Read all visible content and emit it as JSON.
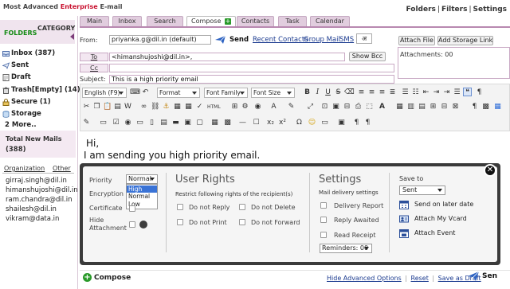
{
  "brand": {
    "prefix": "Most Advanced ",
    "highlight": "Enterprise",
    "suffix": " E-mail"
  },
  "top_links": [
    "Folders",
    "Filters",
    "Settings"
  ],
  "tabs": [
    "Main",
    "Inbox",
    "Search",
    "Compose",
    "Contacts",
    "Task",
    "Calendar"
  ],
  "sidebar": {
    "folders_title": "FOLDERS",
    "category_title": "CATEGORY",
    "folders": [
      {
        "label": "Inbox (387)"
      },
      {
        "label": "Sent"
      },
      {
        "label": "Draft"
      },
      {
        "label": "Trash[Empty] (14)"
      },
      {
        "label": "Secure (1)"
      },
      {
        "label": "Storage"
      }
    ],
    "more": "2 More..",
    "new_mail_label": "Total New Mails",
    "new_mail_count": "(388)",
    "org_label": "Organization",
    "other_label": "Other",
    "contacts": [
      "girraj.singh@dil.in",
      "himanshujoshi@dil.in",
      "ram.chandra@dil.in",
      "shailesh@dil.in",
      "vikram@data.in"
    ]
  },
  "compose": {
    "from_label": "From:",
    "from_value": "priyanka.g@dil.in (default)",
    "send_label": "Send",
    "links": [
      "Recent Contacts",
      "Group Mail",
      "SMS"
    ],
    "lang_glyph": "अ",
    "attach_file": "Attach File",
    "add_storage": "Add Storage Link",
    "to_label": "To",
    "to_value": "<himanshujoshi@dil.in>,",
    "show_bcc": "Show Bcc",
    "cc_label": "Cc",
    "cc_value": "",
    "subject_label": "Subject:",
    "subject_value": "This is a high priority email",
    "attachments_label": "Attachments: 00"
  },
  "toolbar": {
    "language": "English (F9)",
    "format": "Format",
    "font_family": "Font Family",
    "font_size": "Font Size"
  },
  "body": {
    "greeting": "Hi,",
    "message": "I am sending you high priority email."
  },
  "options": {
    "priority_label": "Priority",
    "priority_value": "Normal",
    "priority_options": [
      "High",
      "Normal",
      "Low"
    ],
    "encryption_label": "Encryption",
    "certificate_label": "Certificate",
    "hide_attachment_label": "Hide Attachment",
    "user_rights_title": "User Rights",
    "user_rights_sub": "Restrict following rights of the recipient(s)",
    "rights": [
      "Do not Reply",
      "Do not Delete",
      "Do not Print",
      "Do not Forward"
    ],
    "settings_title": "Settings",
    "settings_sub": "Mail delivery settings",
    "settings_items": [
      "Delivery Report",
      "Reply Awaited",
      "Read Receipt"
    ],
    "reminders_value": "Reminders: 00",
    "save_to_label": "Save to",
    "save_to_value": "Sent",
    "actions": [
      "Send on later date",
      "Attach My Vcard",
      "Attach Event"
    ],
    "close_glyph": "✕"
  },
  "bottom": {
    "compose_label": "Compose",
    "hide_advanced": "Hide Advanced Options",
    "reset": "Reset",
    "save_as_draft": "Save as Draft",
    "send_label": "Sen",
    "divider": "|"
  }
}
